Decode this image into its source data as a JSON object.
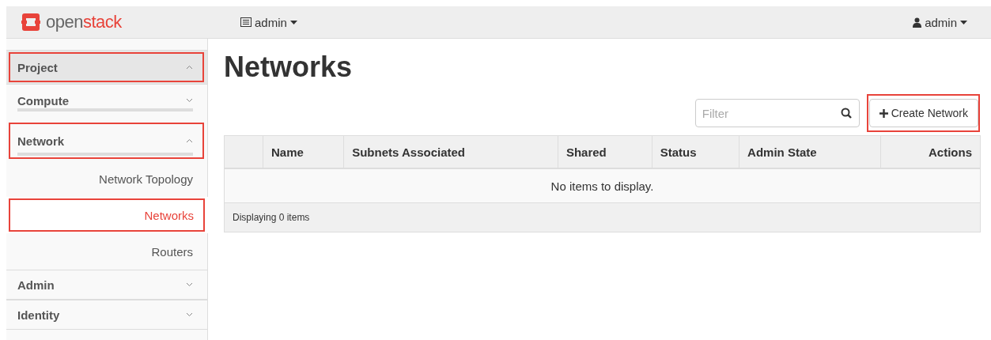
{
  "topbar": {
    "brand_prefix": "open",
    "brand_suffix": "stack",
    "project_menu": "admin",
    "user_menu": "admin"
  },
  "sidebar": [
    {
      "label": "Project",
      "kind": "panel",
      "expanded": true,
      "highlighted": true,
      "children": [
        {
          "label": "Compute",
          "kind": "group",
          "expanded": false,
          "highlighted": false
        },
        {
          "label": "Network",
          "kind": "group",
          "expanded": true,
          "highlighted": true,
          "children": [
            {
              "label": "Network Topology",
              "kind": "link",
              "selected": false,
              "highlighted": false
            },
            {
              "label": "Networks",
              "kind": "link",
              "selected": true,
              "highlighted": true
            },
            {
              "label": "Routers",
              "kind": "link",
              "selected": false,
              "highlighted": false
            }
          ]
        }
      ]
    },
    {
      "label": "Admin",
      "kind": "panel",
      "expanded": false,
      "highlighted": false
    },
    {
      "label": "Identity",
      "kind": "panel",
      "expanded": false,
      "highlighted": false
    }
  ],
  "page_title": "Networks",
  "filter": {
    "placeholder": "Filter"
  },
  "create_button": {
    "label": "Create Network",
    "highlighted": true
  },
  "table": {
    "columns": [
      "Name",
      "Subnets Associated",
      "Shared",
      "Status",
      "Admin State",
      "Actions"
    ],
    "empty_message": "No items to display.",
    "footer": "Displaying 0 items"
  }
}
